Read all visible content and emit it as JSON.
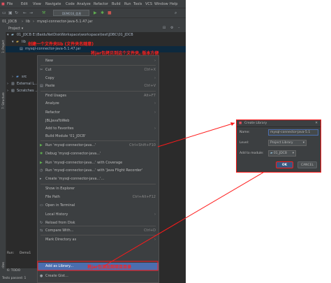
{
  "menubar": {
    "items": [
      "File",
      "Edit",
      "View",
      "Navigate",
      "Code",
      "Analyze",
      "Refactor",
      "Build",
      "Run",
      "Tools",
      "VCS",
      "Window",
      "Help"
    ]
  },
  "toolbar": {
    "run_config": "DEMO16_信息化.TESTS"
  },
  "breadcrumb": {
    "project": "01_JDCB",
    "folder": "lib",
    "file": "mysql-connector-java-5.1.47.jar"
  },
  "project_panel": {
    "title": "Project",
    "rows": [
      {
        "label": "01_JDCB  E:\\BaiduNetDiskWorkspace\\workspace\\test\\JDBC\\01_JDCB"
      },
      {
        "label": "lib"
      },
      {
        "label": "mysql-connector-java-5.1.47.jar"
      },
      {
        "label": "src"
      },
      {
        "label": "External L..."
      },
      {
        "label": "Scratches ..."
      }
    ]
  },
  "side_labels": {
    "project": "1: Project",
    "structure": "7: Structure",
    "favorites": "2: Favorites"
  },
  "annotations": {
    "step1": "创建一个文件夹lib (文件夹名随意)",
    "step2": "将jar包拷贝到这个文件夹, 版本方便",
    "step3": "将jar包添加到项目目录"
  },
  "context_menu": {
    "items": [
      {
        "label": "New",
        "shortcut": "",
        "submenu": true,
        "icon": ""
      },
      {
        "label": "Cut",
        "shortcut": "Ctrl+X",
        "icon": "scissors-icon"
      },
      {
        "label": "Copy",
        "shortcut": "",
        "submenu": true,
        "icon": ""
      },
      {
        "label": "Paste",
        "shortcut": "Ctrl+V",
        "icon": "paste-icon"
      },
      {
        "label": "Find Usages",
        "shortcut": "Alt+F7",
        "icon": ""
      },
      {
        "label": "Analyze",
        "shortcut": "",
        "submenu": true,
        "icon": ""
      },
      {
        "label": "Refactor",
        "shortcut": "",
        "submenu": true,
        "icon": ""
      },
      {
        "label": "JBLJavaToWeb",
        "shortcut": "",
        "icon": ""
      },
      {
        "label": "Add to Favorites",
        "shortcut": "",
        "submenu": true,
        "icon": ""
      },
      {
        "label": "Build Module '01_JDCB'",
        "shortcut": "",
        "icon": ""
      },
      {
        "label": "Run 'mysql-connector-java...'",
        "shortcut": "Ctrl+Shift+F10",
        "icon": "run-icon"
      },
      {
        "label": "Debug 'mysql-connector-java...'",
        "shortcut": "",
        "icon": "debug-icon"
      },
      {
        "label": "Run 'mysql-connector-java...' with Coverage",
        "shortcut": "",
        "icon": "coverage-icon"
      },
      {
        "label": "Run 'mysql-connector-java...' with 'Java Flight Recorder'",
        "shortcut": "",
        "icon": "profiler-icon"
      },
      {
        "label": "Create 'mysql-connector-java...'...",
        "shortcut": "",
        "icon": "config-icon"
      },
      {
        "label": "Show in Explorer",
        "shortcut": "",
        "icon": ""
      },
      {
        "label": "File Path",
        "shortcut": "Ctrl+Alt+F12",
        "icon": ""
      },
      {
        "label": "Open in Terminal",
        "shortcut": "",
        "icon": "terminal-icon"
      },
      {
        "label": "Local History",
        "shortcut": "",
        "submenu": true,
        "icon": ""
      },
      {
        "label": "Reload from Disk",
        "shortcut": "",
        "icon": "reload-icon"
      },
      {
        "label": "Compare With...",
        "shortcut": "Ctrl+D",
        "icon": "compare-icon"
      },
      {
        "label": "Mark Directory as",
        "shortcut": "",
        "submenu": true,
        "icon": ""
      },
      {
        "label": "Add as Library...",
        "shortcut": "",
        "icon": ""
      },
      {
        "label": "Create Gist...",
        "shortcut": "",
        "icon": "github-icon"
      }
    ]
  },
  "bottom": {
    "run_tab": "Run:",
    "demo_tab": "Demo1",
    "todo": "6: TODO",
    "status": "Tests passed: 1"
  },
  "dialog": {
    "title": "Create Library",
    "name_label": "Name:",
    "name_value": "mysql-connector-java-5.1",
    "level_label": "Level:",
    "level_value": "Project Library",
    "module_label": "Add to module:",
    "module_value": "01_JDCB",
    "ok_label": "OK",
    "cancel_label": "CANCEL"
  },
  "colors": {
    "ide_bg": "#2b2b2b",
    "panel": "#3c3f41",
    "highlight": "#4b6eaf",
    "annotation": "#ff2020"
  }
}
